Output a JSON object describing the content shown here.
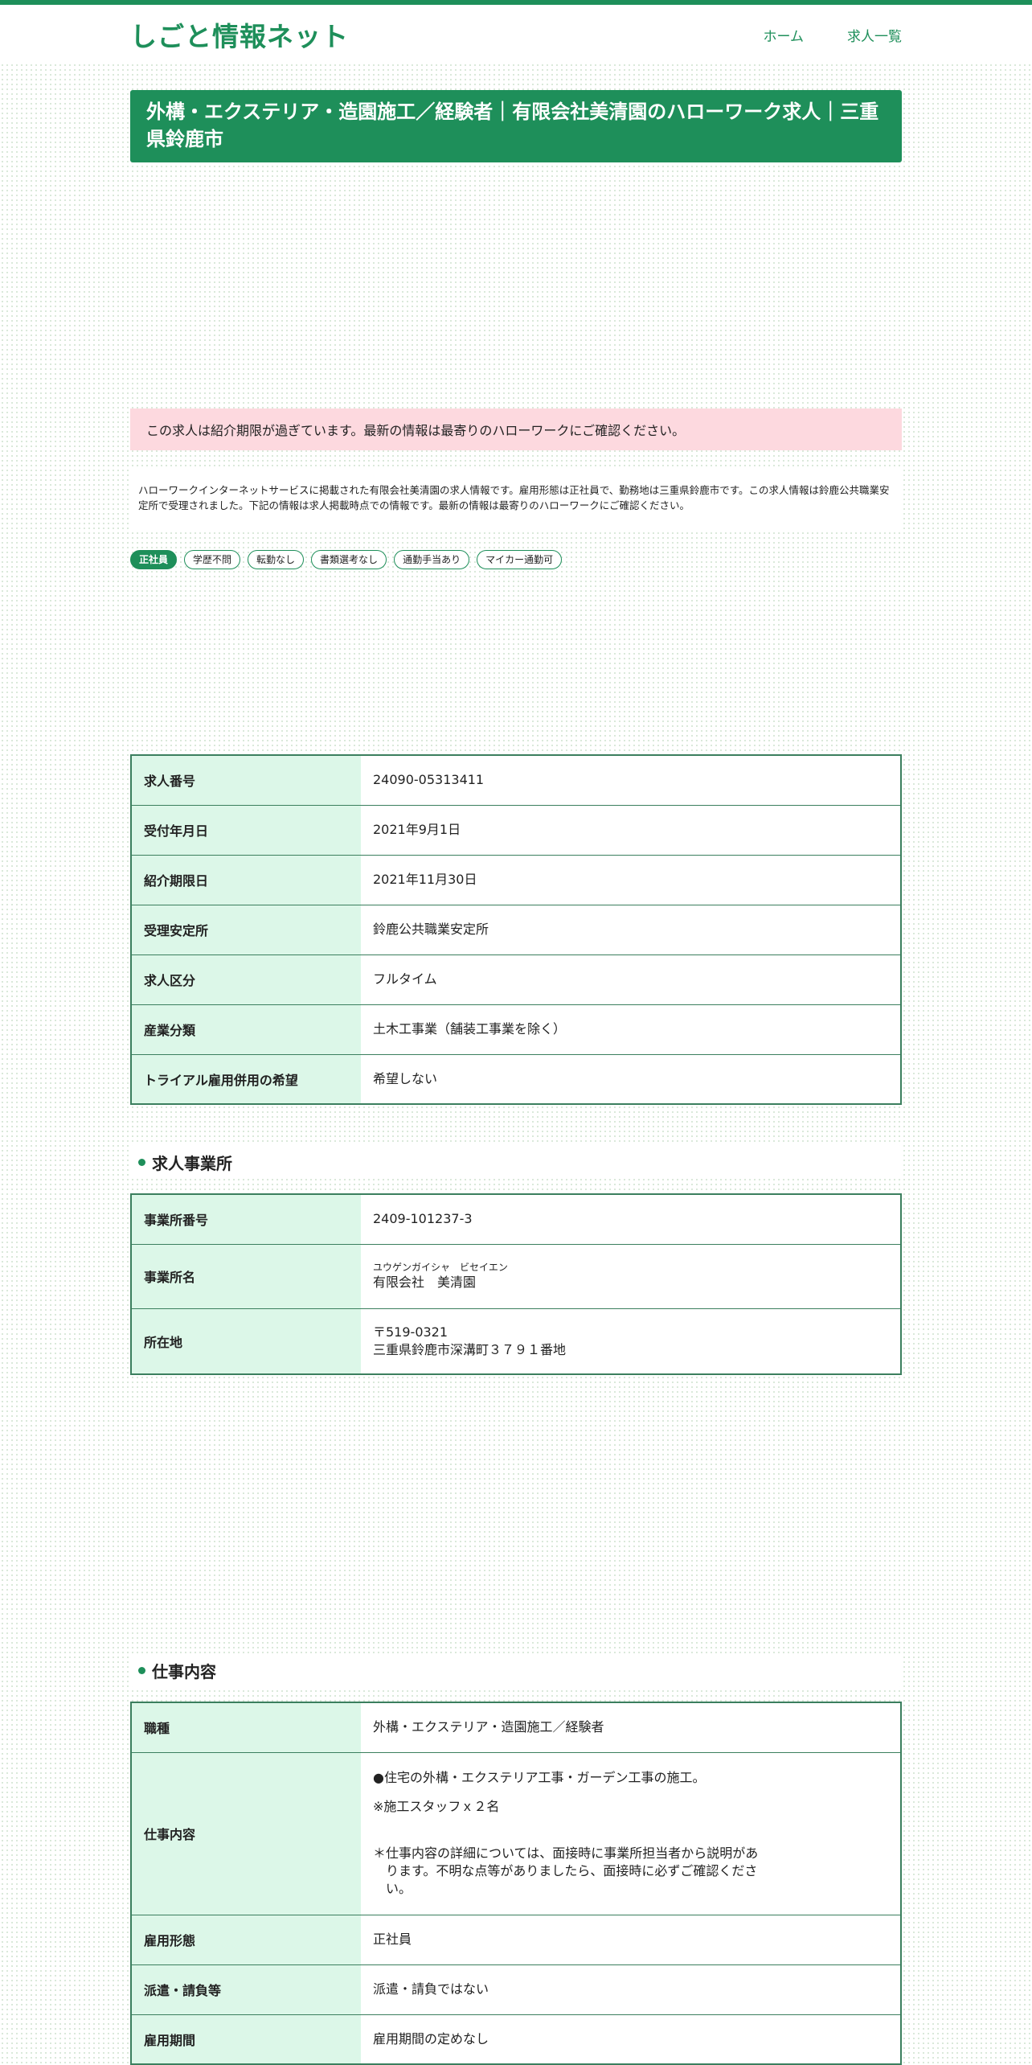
{
  "site": {
    "title": "しごと情報ネット"
  },
  "nav": {
    "home": "ホーム",
    "list": "求人一覧"
  },
  "job": {
    "title": "外構・エクステリア・造園施工／経験者｜有限会社美清園のハローワーク求人｜三重県鈴鹿市",
    "notice": "この求人は紹介期限が過ぎています。最新の情報は最寄りのハローワークにご確認ください。",
    "description": "ハローワークインターネットサービスに掲載された有限会社美清園の求人情報です。雇用形態は正社員で、勤務地は三重県鈴鹿市です。この求人情報は鈴鹿公共職業安定所で受理されました。下記の情報は求人掲載時点での情報です。最新の情報は最寄りのハローワークにご確認ください。",
    "tags": [
      "正社員",
      "学歴不問",
      "転勤なし",
      "書類選考なし",
      "通勤手当あり",
      "マイカー通勤可"
    ]
  },
  "basic_table": [
    {
      "label": "求人番号",
      "value": "24090-05313411"
    },
    {
      "label": "受付年月日",
      "value": "2021年9月1日"
    },
    {
      "label": "紹介期限日",
      "value": "2021年11月30日"
    },
    {
      "label": "受理安定所",
      "value": "鈴鹿公共職業安定所"
    },
    {
      "label": "求人区分",
      "value": "フルタイム"
    },
    {
      "label": "産業分類",
      "value": "土木工事業（舗装工事業を除く）"
    },
    {
      "label": "トライアル雇用併用の希望",
      "value": "希望しない"
    }
  ],
  "office": {
    "heading": "求人事業所",
    "rows": {
      "number_label": "事業所番号",
      "number_value": "2409-101237-3",
      "name_label": "事業所名",
      "name_kana": "ユウゲンガイシャ　ビセイエン",
      "name_value": "有限会社　美清園",
      "address_label": "所在地",
      "postal": "〒519-0321",
      "address": "三重県鈴鹿市深溝町３７９１番地"
    }
  },
  "work": {
    "heading": "仕事内容",
    "rows": {
      "type_label": "職種",
      "type_value": "外構・エクステリア・造園施工／経験者",
      "content_label": "仕事内容",
      "content_line1": "●住宅の外構・エクステリア工事・ガーデン工事の施工。",
      "content_line2": "※施工スタッフｘ２名",
      "content_line3": "＊仕事内容の詳細については、面接時に事業所担当者から説明があ\n　ります。不明な点等がありましたら、面接時に必ずご確認くださ\n　い。",
      "employment_label": "雇用形態",
      "employment_value": "正社員",
      "dispatch_label": "派遣・請負等",
      "dispatch_value": "派遣・請負ではない",
      "period_label": "雇用期間",
      "period_value": "雇用期間の定めなし"
    }
  },
  "colors": {
    "accent": "#1e8f5a",
    "notice_bg": "#fdd9df",
    "table_header_bg": "#dcf7e8"
  }
}
